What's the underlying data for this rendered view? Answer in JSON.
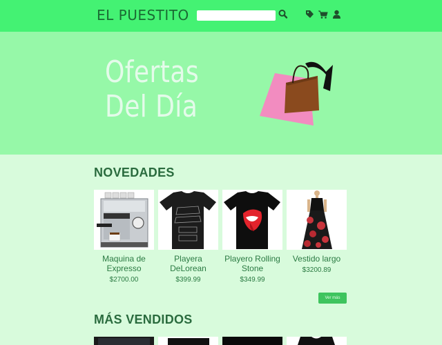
{
  "header": {
    "brand": "EL PUESTITO",
    "search_placeholder": "",
    "icons": [
      "search-icon",
      "tag-icon",
      "cart-icon",
      "user-icon"
    ]
  },
  "hero": {
    "line1": "Ofertas",
    "line2": "Del Día"
  },
  "sections": {
    "novedades": {
      "title": "NOVEDADES",
      "items": [
        {
          "name": "Maquina de Expresso",
          "price": "$2700.00"
        },
        {
          "name": "Playera DeLorean",
          "price": "$399.99"
        },
        {
          "name": "Playero Rolling Stone",
          "price": "$349.99"
        },
        {
          "name": "Vestido largo",
          "price": "$3200.89"
        }
      ],
      "more_label": "Ver más"
    },
    "mas_vendidos": {
      "title": "MÁS VENDIDOS"
    }
  },
  "colors": {
    "header_bg": "#44f273",
    "hero_bg": "#96f8a8",
    "page_bg": "#d8fbdc",
    "text_green": "#2a7a42",
    "button": "#3ec45e"
  }
}
